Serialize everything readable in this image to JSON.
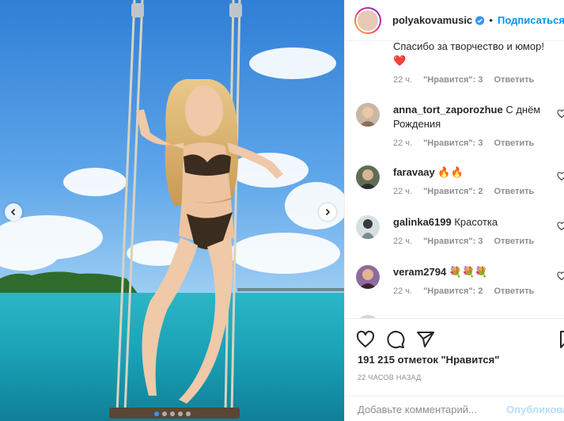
{
  "header": {
    "username": "polyakovamusic",
    "dot": "•",
    "follow_label": "Подписаться"
  },
  "comments": [
    {
      "text": "Спасибо за творчество и юмор!",
      "emoji": "❤️",
      "time": "22 ч.",
      "likes": "\"Нравится\": 3",
      "reply": "Ответить"
    },
    {
      "username": "anna_tort_zaporozhue",
      "text": "С днём Рождения",
      "time": "22 ч.",
      "likes": "\"Нравится\": 3",
      "reply": "Ответить"
    },
    {
      "username": "faravaay",
      "text": "🔥🔥",
      "time": "22 ч.",
      "likes": "\"Нравится\": 2",
      "reply": "Ответить"
    },
    {
      "username": "galinka6199",
      "text": "Красотка",
      "time": "22 ч.",
      "likes": "\"Нравится\": 3",
      "reply": "Ответить"
    },
    {
      "username": "veram2794",
      "text": "💐💐💐",
      "time": "22 ч.",
      "likes": "\"Нравится\": 2",
      "reply": "Ответить"
    }
  ],
  "actions": {
    "likes_count": "191 215 отметок \"Нравится\"",
    "timestamp": "22 ЧАСОВ НАЗАД"
  },
  "add_comment": {
    "placeholder": "Добавьте комментарий...",
    "publish_label": "Опубликовать"
  },
  "icons": [
    "chevron-left-icon",
    "chevron-right-icon",
    "verified-icon",
    "heart-icon",
    "comment-icon",
    "share-icon",
    "bookmark-icon"
  ],
  "colors": {
    "accent": "#0095f6",
    "publish_disabled": "#b2dffc",
    "like_heart": "#ed4956"
  }
}
